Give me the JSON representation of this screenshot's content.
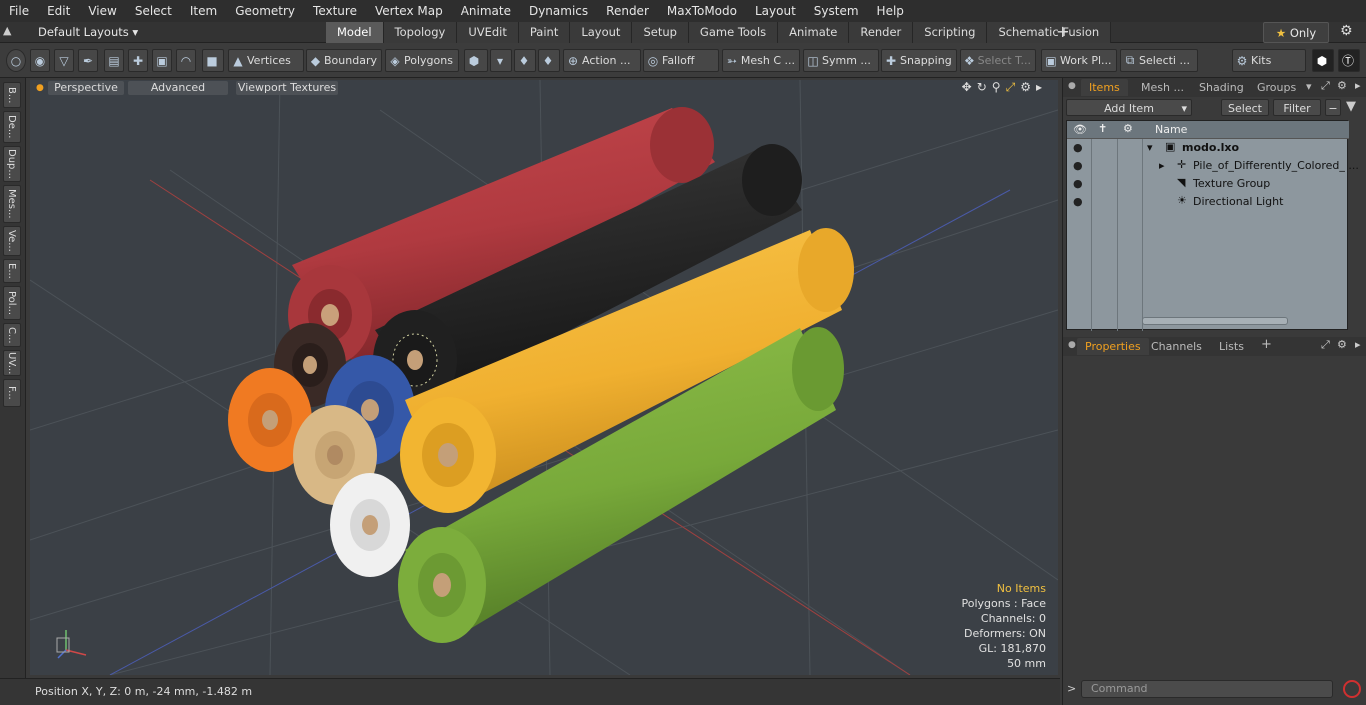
{
  "menu": [
    "File",
    "Edit",
    "View",
    "Select",
    "Item",
    "Geometry",
    "Texture",
    "Vertex Map",
    "Animate",
    "Dynamics",
    "Render",
    "MaxToModo",
    "Layout",
    "System",
    "Help"
  ],
  "layout_selector": "Default Layouts",
  "tabs": [
    "Model",
    "Topology",
    "UVEdit",
    "Paint",
    "Layout",
    "Setup",
    "Game Tools",
    "Animate",
    "Render",
    "Scripting",
    "Schematic Fusion"
  ],
  "active_tab": "Model",
  "only_label": "Only",
  "toolbar": {
    "vertices": "Vertices",
    "boundary": "Boundary",
    "polygons": "Polygons",
    "action": "Action ...",
    "falloff": "Falloff",
    "mesh": "Mesh C ...",
    "symm": "Symm ...",
    "snapping": "Snapping",
    "select_t": "Select T...",
    "work_plane": "Work Pl...",
    "selecti": "Selecti ...",
    "kits": "Kits"
  },
  "left_tools": [
    "B...",
    "De...",
    "Dup...",
    "Mes...",
    "Ve...",
    "E...",
    "Pol...",
    "C...",
    "UV...",
    "F..."
  ],
  "viewport": {
    "perspective": "Perspective",
    "advanced": "Advanced",
    "viewport_textures": "Viewport Textures",
    "stats": {
      "no_items": "No Items",
      "polygons": "Polygons : Face",
      "channels": "Channels: 0",
      "deformers": "Deformers: ON",
      "gl": "GL: 181,870",
      "scale": "50 mm"
    }
  },
  "status": "Position X, Y, Z:  0 m, -24 mm, -1.482 m",
  "right_panel": {
    "tabs_top": [
      "Items",
      "Mesh ...",
      "Shading",
      "Groups"
    ],
    "add_item": "Add Item",
    "select": "Select",
    "filter": "Filter",
    "name_header": "Name",
    "tree": [
      "modo.lxo",
      "Pile_of_Differently_Colored_ ...",
      "Texture Group",
      "Directional Light"
    ],
    "tabs_bottom": [
      "Properties",
      "Channels",
      "Lists"
    ],
    "command_placeholder": "Command"
  },
  "colors": {
    "accent": "#f0a020",
    "roll_red": "#b83a40",
    "roll_black": "#262626",
    "roll_yellow": "#f2b531",
    "roll_green": "#7cad3c",
    "roll_orange": "#f07a22",
    "roll_blue": "#3558a8",
    "roll_beige": "#d8b886",
    "roll_white": "#f0f0f0",
    "roll_brown": "#3a2a26"
  }
}
